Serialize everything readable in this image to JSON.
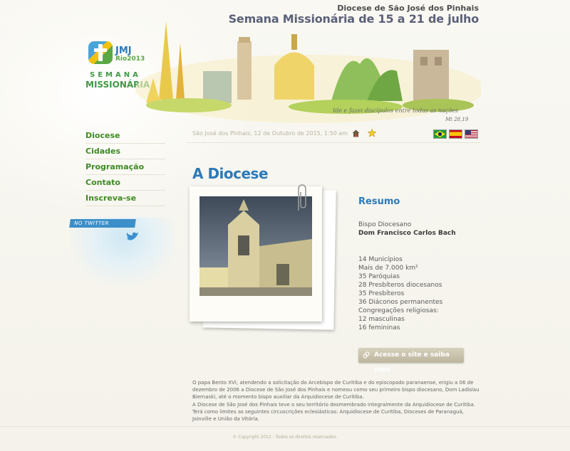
{
  "header": {
    "subtitle": "Diocese de São José dos Pinhais",
    "title": "Semana Missionária de 15 a 21 de julho",
    "banner_caption": "Ide e fazei discípulos entre todas as nações",
    "banner_verse": "Mt 28,19"
  },
  "logo": {
    "jmj": "JMJ",
    "rio": "Rio2013",
    "semana": "SEMANA",
    "missionaria": "MISSIONÁRIA"
  },
  "nav": {
    "items": [
      {
        "label": "Diocese"
      },
      {
        "label": "Cidades"
      },
      {
        "label": "Programação"
      },
      {
        "label": "Contato"
      },
      {
        "label": "Inscreva-se"
      }
    ]
  },
  "twitter": {
    "label": "NO TWITTER"
  },
  "topbar": {
    "date": "São José dos Pinhais, 12 de Outubro de 2015, 1:50 am",
    "home_icon": "home-icon",
    "favorite_icon": "star-icon",
    "languages": [
      "Português",
      "Español",
      "English"
    ]
  },
  "main": {
    "title": "A Diocese",
    "resumo": {
      "title": "Resumo",
      "bispo_label": "Bispo Diocesano",
      "bispo_name": "Dom Francisco Carlos Bach",
      "stats": [
        "14 Municípios",
        "Mais de 7.000 km²",
        "35 Paróquias",
        "28 Presbíteros diocesanos",
        "35 Presbíteros",
        "36 Diáconos permanentes",
        "Congregações religiosas:",
        "12 masculinas",
        "16 femininas"
      ],
      "cta_label": "Acesse o site e saiba mais"
    },
    "paragraphs": [
      "O papa Bento XVI, atendendo a solicitação do Arcebispo de Curitiba e do episcopado paranaense, erigiu a 06 de dezembro de 2006 a Diocese de São José dos Pinhais e nomeou como seu primeiro bispo diocesano, Dom Ladislau Biernaski, até o momento bispo auxiliar da Arquidiocese de Curitiba.",
      "A Diocese de São José dos Pinhais teve o seu território desmembrado integralmente da Arquidiocese de Curitiba. Terá como limites as seguintes circuscrições eclesiásticas: Arquidiocese de Curitiba, Dioceses de Paranaguá, Joinville e União da Vitória."
    ]
  },
  "footer": {
    "copyright": "© Copyright 2012 - Todos os direitos reservados."
  },
  "colors": {
    "accent_blue": "#2d7ab8",
    "nav_green": "#3d8b21",
    "header_title": "#5b6178",
    "background": "#f7f5ee"
  }
}
